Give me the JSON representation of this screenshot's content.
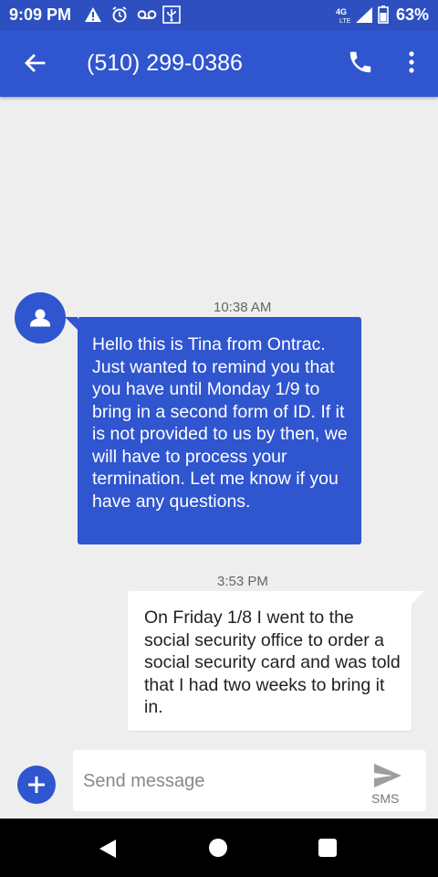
{
  "status_bar": {
    "time": "9:09 PM",
    "battery": "63%",
    "icons": [
      "warning-icon",
      "alarm-icon",
      "voicemail-icon",
      "usb-icon",
      "signal-4g-icon",
      "battery-icon"
    ]
  },
  "app_bar": {
    "title": "(510) 299-0386",
    "icons": [
      "back-arrow-icon",
      "phone-icon",
      "more-vert-icon"
    ]
  },
  "conversation": {
    "messages": [
      {
        "direction": "incoming",
        "time": "10:38 AM",
        "text": "Hello this is Tina from Ontrac. Just wanted to remind you that you have until Monday 1/9 to bring in a second form of ID. If it is not provided to us by then, we will have to process your termination. Let me know if you have any questions."
      },
      {
        "direction": "outgoing",
        "time": "3:53 PM",
        "text": "On Friday 1/8 I went to the social security office to order a social security card and was told that I had two weeks to bring it in."
      }
    ]
  },
  "compose": {
    "placeholder": "Send message",
    "send_label": "SMS"
  },
  "colors": {
    "status_bar": "#2d4fc0",
    "app_bar": "#2f55cf",
    "incoming_bubble": "#2f55cf",
    "outgoing_bubble": "#ffffff",
    "background": "#eeeeee"
  }
}
